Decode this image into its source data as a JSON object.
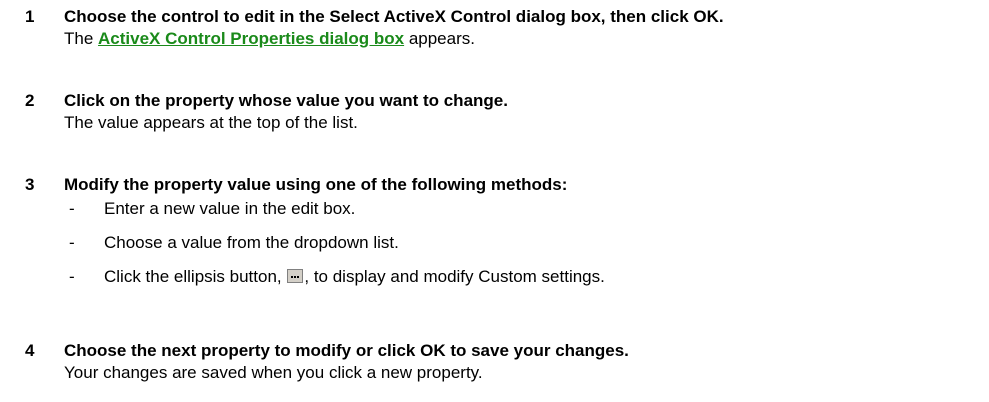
{
  "steps": [
    {
      "number": "1",
      "title": "Choose the control to edit in the Select ActiveX Control dialog box, then click OK.",
      "desc_before": "The ",
      "desc_link": "ActiveX Control Properties dialog box",
      "desc_after": " appears."
    },
    {
      "number": "2",
      "title": "Click on the property whose value you want to change.",
      "desc": "The value appears at the top of the list."
    },
    {
      "number": "3",
      "title": "Modify the property value using one of the following methods:",
      "sub_items": [
        {
          "dash": "-",
          "text": "Enter a new value in the edit box."
        },
        {
          "dash": "-",
          "text": "Choose a value from the dropdown list."
        },
        {
          "dash": "-",
          "text_before": "Click the ellipsis button, ",
          "icon": "ellipsis-button-icon",
          "text_after": ", to display and modify Custom settings."
        }
      ]
    },
    {
      "number": "4",
      "title": "Choose the next property to modify or click OK to save your changes.",
      "desc": "Your changes are saved when you click a new property."
    }
  ],
  "colors": {
    "link": "#1a8a1a",
    "text": "#000000",
    "background": "#ffffff"
  }
}
